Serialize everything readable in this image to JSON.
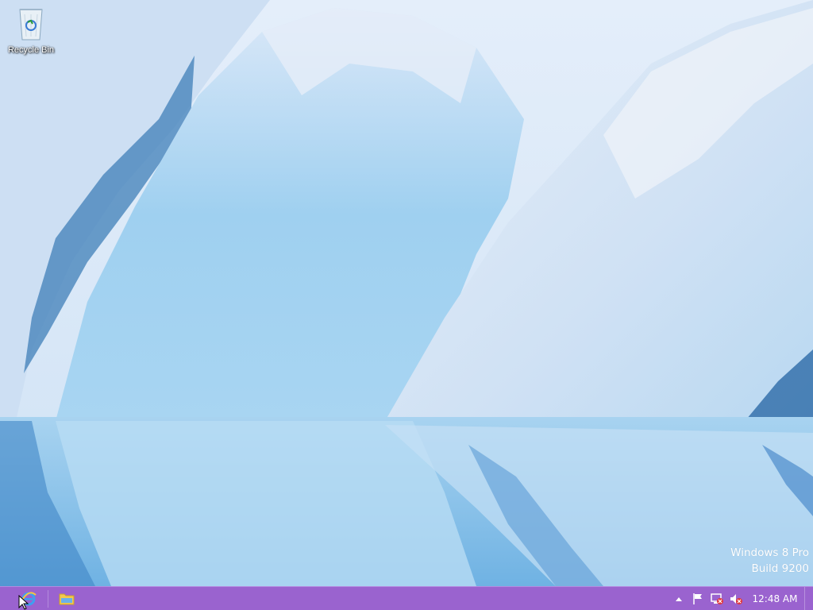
{
  "desktop": {
    "icons": [
      {
        "label": "Recycle Bin",
        "icon": "recycle-bin-icon"
      }
    ]
  },
  "watermark": {
    "line1": "Windows 8 Pro",
    "line2": "Build 9200"
  },
  "taskbar": {
    "color": "#9a63cf",
    "pinned": [
      {
        "icon": "internet-explorer-icon"
      },
      {
        "icon": "file-explorer-icon"
      }
    ],
    "tray": {
      "icons": [
        "show-hidden-icons-chevron",
        "action-center-flag-icon",
        "network-disconnected-icon",
        "volume-muted-icon"
      ],
      "clock": "12:48 AM"
    }
  }
}
